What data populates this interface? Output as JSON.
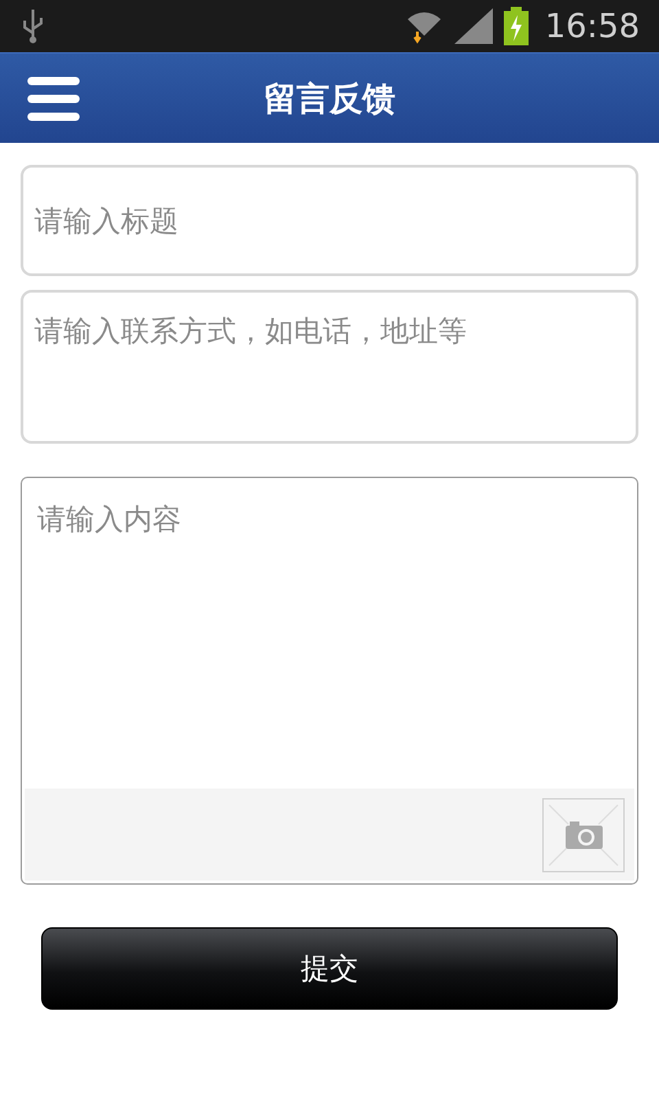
{
  "status_bar": {
    "time": "16:58"
  },
  "header": {
    "title": "留言反馈"
  },
  "form": {
    "title_field": {
      "placeholder": "请输入标题"
    },
    "contact_field": {
      "placeholder": "请输入联系方式，如电话，地址等"
    },
    "content_field": {
      "placeholder": "请输入内容"
    }
  },
  "submit_button": {
    "label": "提交"
  }
}
